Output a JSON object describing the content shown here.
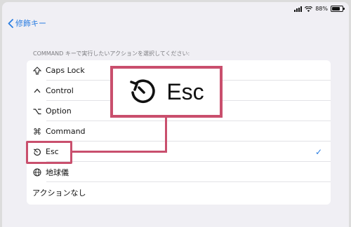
{
  "status": {
    "battery_text": "88%"
  },
  "nav": {
    "back_label": "修飾キー"
  },
  "section": {
    "header": "COMMAND キーで実行したいアクションを選択してください:"
  },
  "options": [
    {
      "label": "Caps Lock",
      "icon": "caps-lock-icon"
    },
    {
      "label": "Control",
      "icon": "control-icon"
    },
    {
      "label": "Option",
      "icon": "option-icon"
    },
    {
      "label": "Command",
      "icon": "command-icon"
    },
    {
      "label": "Esc",
      "icon": "escape-icon",
      "selected": true
    },
    {
      "label": "地球儀",
      "icon": "globe-icon"
    },
    {
      "label": "アクションなし",
      "icon": ""
    }
  ],
  "callout": {
    "label": "Esc",
    "icon": "escape-icon"
  },
  "colors": {
    "accent": "#2a7de1",
    "highlight": "#c94f6d"
  }
}
